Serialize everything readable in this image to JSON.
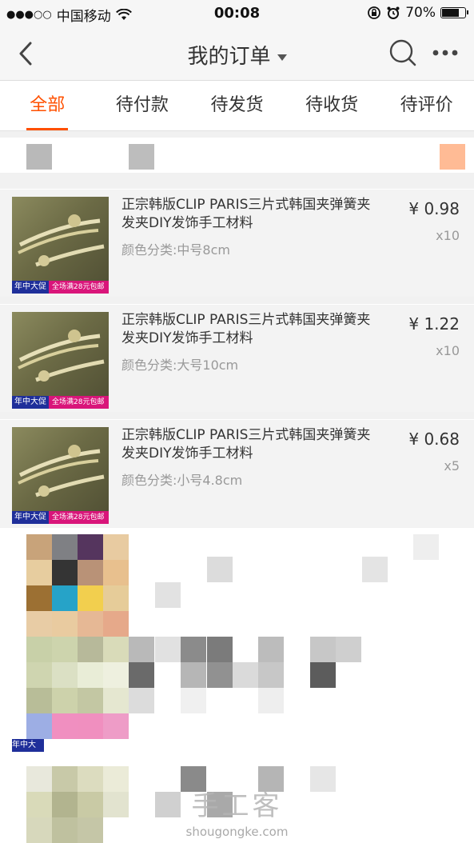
{
  "status_bar": {
    "carrier": "中国移动",
    "time": "00:08",
    "battery": "70%"
  },
  "nav": {
    "title": "我的订单",
    "back_icon": "chevron-left-icon",
    "search_icon": "search-icon",
    "more_icon": "more-icon"
  },
  "tabs": [
    {
      "label": "全部",
      "active": true
    },
    {
      "label": "待付款",
      "active": false
    },
    {
      "label": "待发货",
      "active": false
    },
    {
      "label": "待收货",
      "active": false
    },
    {
      "label": "待评价",
      "active": false
    }
  ],
  "items": [
    {
      "title": "正宗韩版CLIP PARIS三片式韩国夹弹簧夹发夹DIY发饰手工材料",
      "spec": "颜色分类:中号8cm",
      "price": "¥ 0.98",
      "qty": "x10",
      "promo_a": "年中大促",
      "promo_b": "全场满28元包邮"
    },
    {
      "title": "正宗韩版CLIP PARIS三片式韩国夹弹簧夹发夹DIY发饰手工材料",
      "spec": "颜色分类:大号10cm",
      "price": "¥ 1.22",
      "qty": "x10",
      "promo_a": "年中大促",
      "promo_b": "全场满28元包邮"
    },
    {
      "title": "正宗韩版CLIP PARIS三片式韩国夹弹簧夹发夹DIY发饰手工材料",
      "spec": "颜色分类:小号4.8cm",
      "price": "¥ 0.68",
      "qty": "x5",
      "promo_a": "年中大促",
      "promo_b": "全场满28元包邮"
    }
  ],
  "lower_item": {
    "promo_a": "年中大"
  },
  "watermark": {
    "line1": "手工客",
    "line2": "shougongke.com"
  },
  "colors": {
    "accent": "#ff5000",
    "promo_pink": "#d9157a",
    "promo_blue": "#1f2f9a"
  }
}
